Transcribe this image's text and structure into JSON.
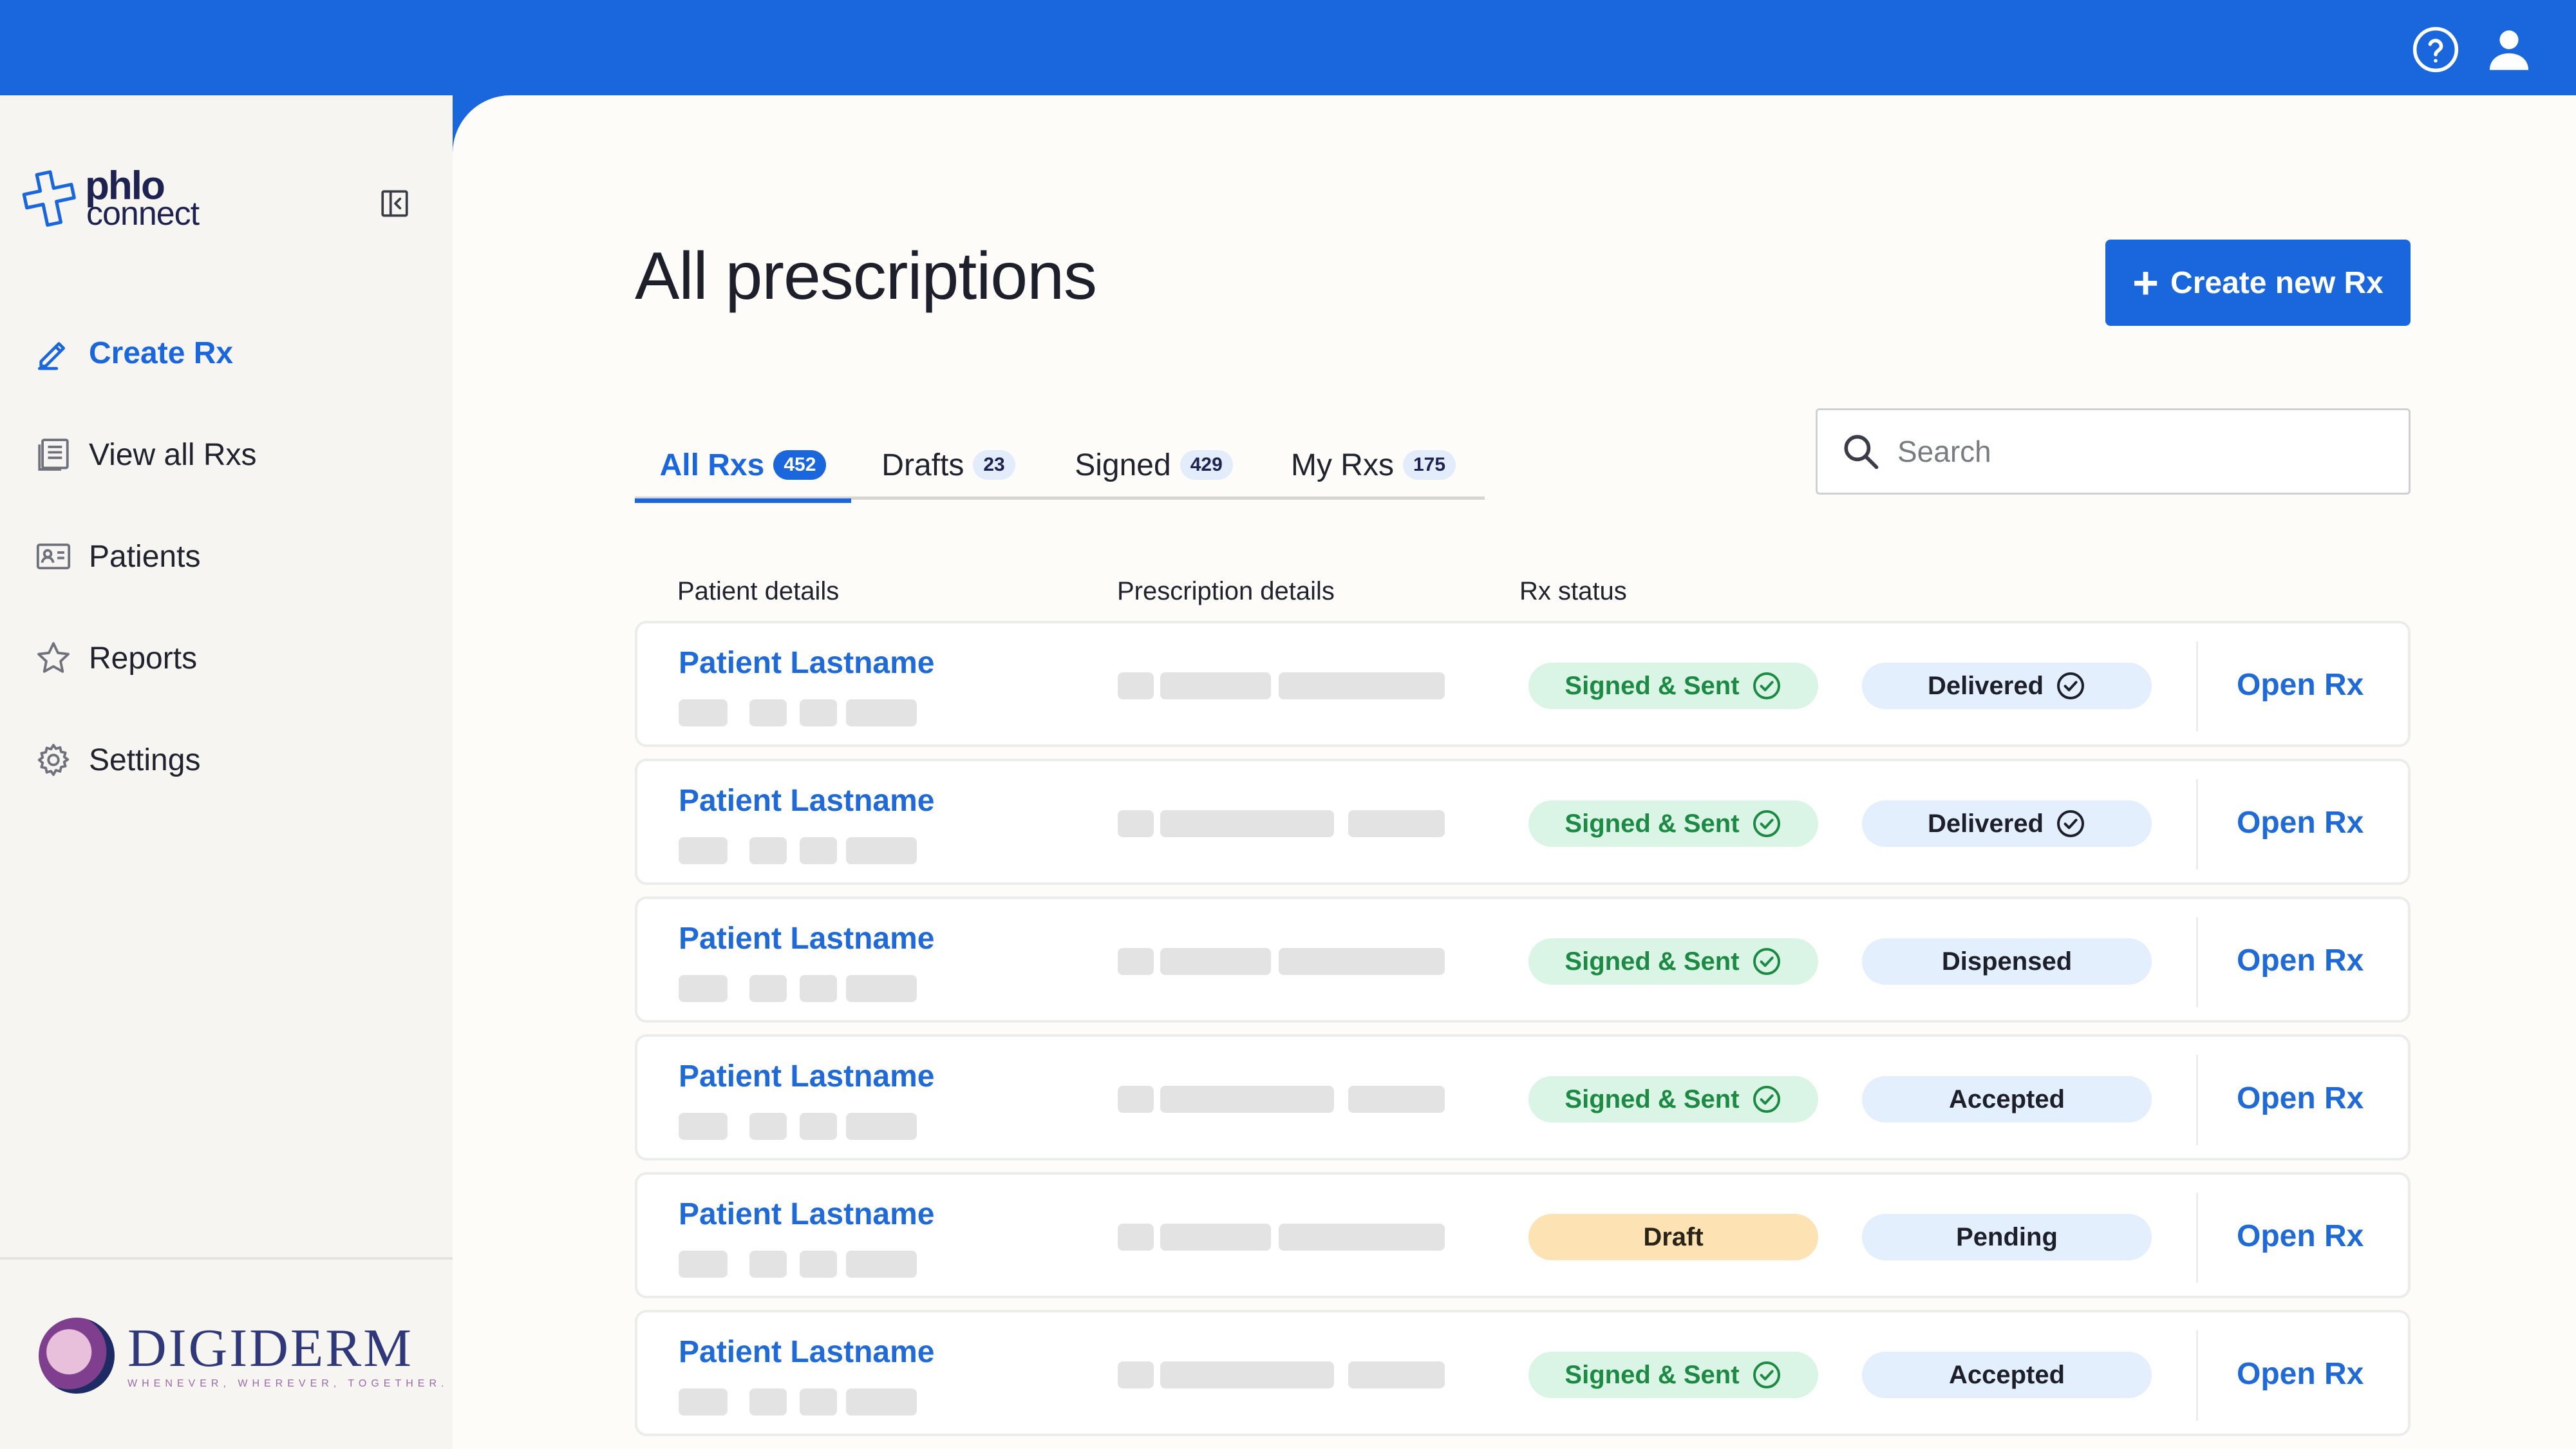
{
  "topbar": {
    "help_icon": "help-circle-icon",
    "user_icon": "user-icon"
  },
  "sidebar": {
    "logo": {
      "line1": "phlo",
      "line2": "connect"
    },
    "items": [
      {
        "label": "Create Rx",
        "icon": "pen-icon",
        "active": true
      },
      {
        "label": "View all Rxs",
        "icon": "list-icon",
        "active": false
      },
      {
        "label": "Patients",
        "icon": "id-card-icon",
        "active": false
      },
      {
        "label": "Reports",
        "icon": "star-icon",
        "active": false
      },
      {
        "label": "Settings",
        "icon": "gear-icon",
        "active": false
      }
    ],
    "partner": {
      "name": "DIGIDERM",
      "tagline": "WHENEVER, WHEREVER, TOGETHER."
    }
  },
  "main": {
    "title": "All prescriptions",
    "create_button": "Create new Rx",
    "tabs": [
      {
        "label": "All Rxs",
        "count": "452",
        "active": true
      },
      {
        "label": "Drafts",
        "count": "23",
        "active": false
      },
      {
        "label": "Signed",
        "count": "429",
        "active": false
      },
      {
        "label": "My Rxs",
        "count": "175",
        "active": false
      }
    ],
    "search": {
      "placeholder": "Search"
    },
    "columns": {
      "patient": "Patient details",
      "prescription": "Prescription details",
      "status": "Rx status"
    },
    "rows": [
      {
        "patient": "Patient Lastname",
        "rx_status": "Signed & Sent",
        "delivery_status": "Delivered",
        "action": "Open Rx"
      },
      {
        "patient": "Patient Lastname",
        "rx_status": "Signed & Sent",
        "delivery_status": "Delivered",
        "action": "Open Rx"
      },
      {
        "patient": "Patient Lastname",
        "rx_status": "Signed & Sent",
        "delivery_status": "Dispensed",
        "action": "Open Rx"
      },
      {
        "patient": "Patient Lastname",
        "rx_status": "Signed & Sent",
        "delivery_status": "Accepted",
        "action": "Open Rx"
      },
      {
        "patient": "Patient Lastname",
        "rx_status": "Draft",
        "delivery_status": "Pending",
        "action": "Open Rx"
      },
      {
        "patient": "Patient Lastname",
        "rx_status": "Signed & Sent",
        "delivery_status": "Accepted",
        "action": "Open Rx"
      }
    ]
  },
  "colors": {
    "accent": "#1a66dd",
    "signed_bg": "#daf5e6",
    "signed_text": "#1d8a44",
    "draft_bg": "#fde2b3",
    "delivery_bg": "#e3effc"
  }
}
